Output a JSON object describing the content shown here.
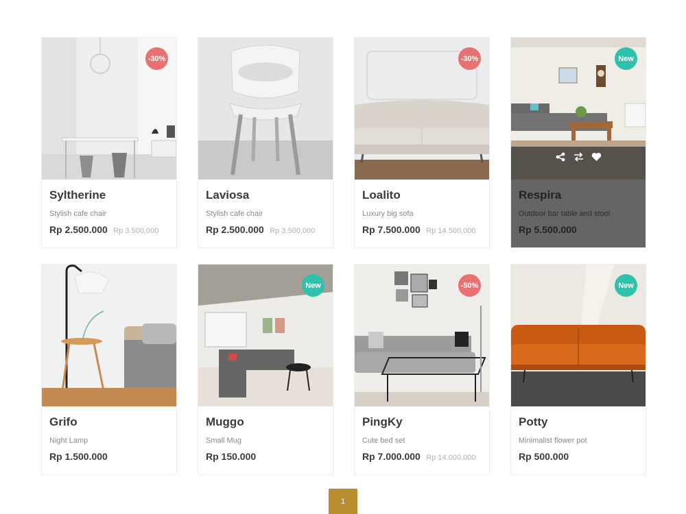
{
  "products": [
    {
      "name": "Syltherine",
      "desc": "Stylish cafe chair",
      "price": "Rp 2.500.000",
      "old_price": "Rp 3.500,000",
      "badge": "-30%"
    },
    {
      "name": "Laviosa",
      "desc": "Stylish cafe chair",
      "price": "Rp 2.500.000",
      "old_price": "Rp 3.500,000",
      "badge": ""
    },
    {
      "name": "Loalito",
      "desc": "Luxury big sofa",
      "price": "Rp 7.500.000",
      "old_price": "Rp 14.500,000",
      "badge": "-30%"
    },
    {
      "name": "Respira",
      "desc": "Outdoor bar table and stool",
      "price": "Rp 5.500.000",
      "old_price": "",
      "badge": "New"
    },
    {
      "name": "Grifo",
      "desc": "Night Lamp",
      "price": "Rp 1.500.000",
      "old_price": "",
      "badge": ""
    },
    {
      "name": "Muggo",
      "desc": "Small Mug",
      "price": "Rp 150.000",
      "old_price": "",
      "badge": "New"
    },
    {
      "name": "PingKy",
      "desc": "Cute bed set",
      "price": "Rp 7.000.000",
      "old_price": "Rp 14.000.000",
      "badge": "-50%"
    },
    {
      "name": "Potty",
      "desc": "Minimalist flower pot",
      "price": "Rp 500.000",
      "old_price": "",
      "badge": "New"
    }
  ],
  "pagination": {
    "current": "1"
  },
  "icons": {
    "share": "share-icon",
    "compare": "compare-icon",
    "like": "heart-icon"
  },
  "colors": {
    "sale_badge": "#e97171",
    "new_badge": "#2ec1ac",
    "accent": "#b88e2f"
  }
}
